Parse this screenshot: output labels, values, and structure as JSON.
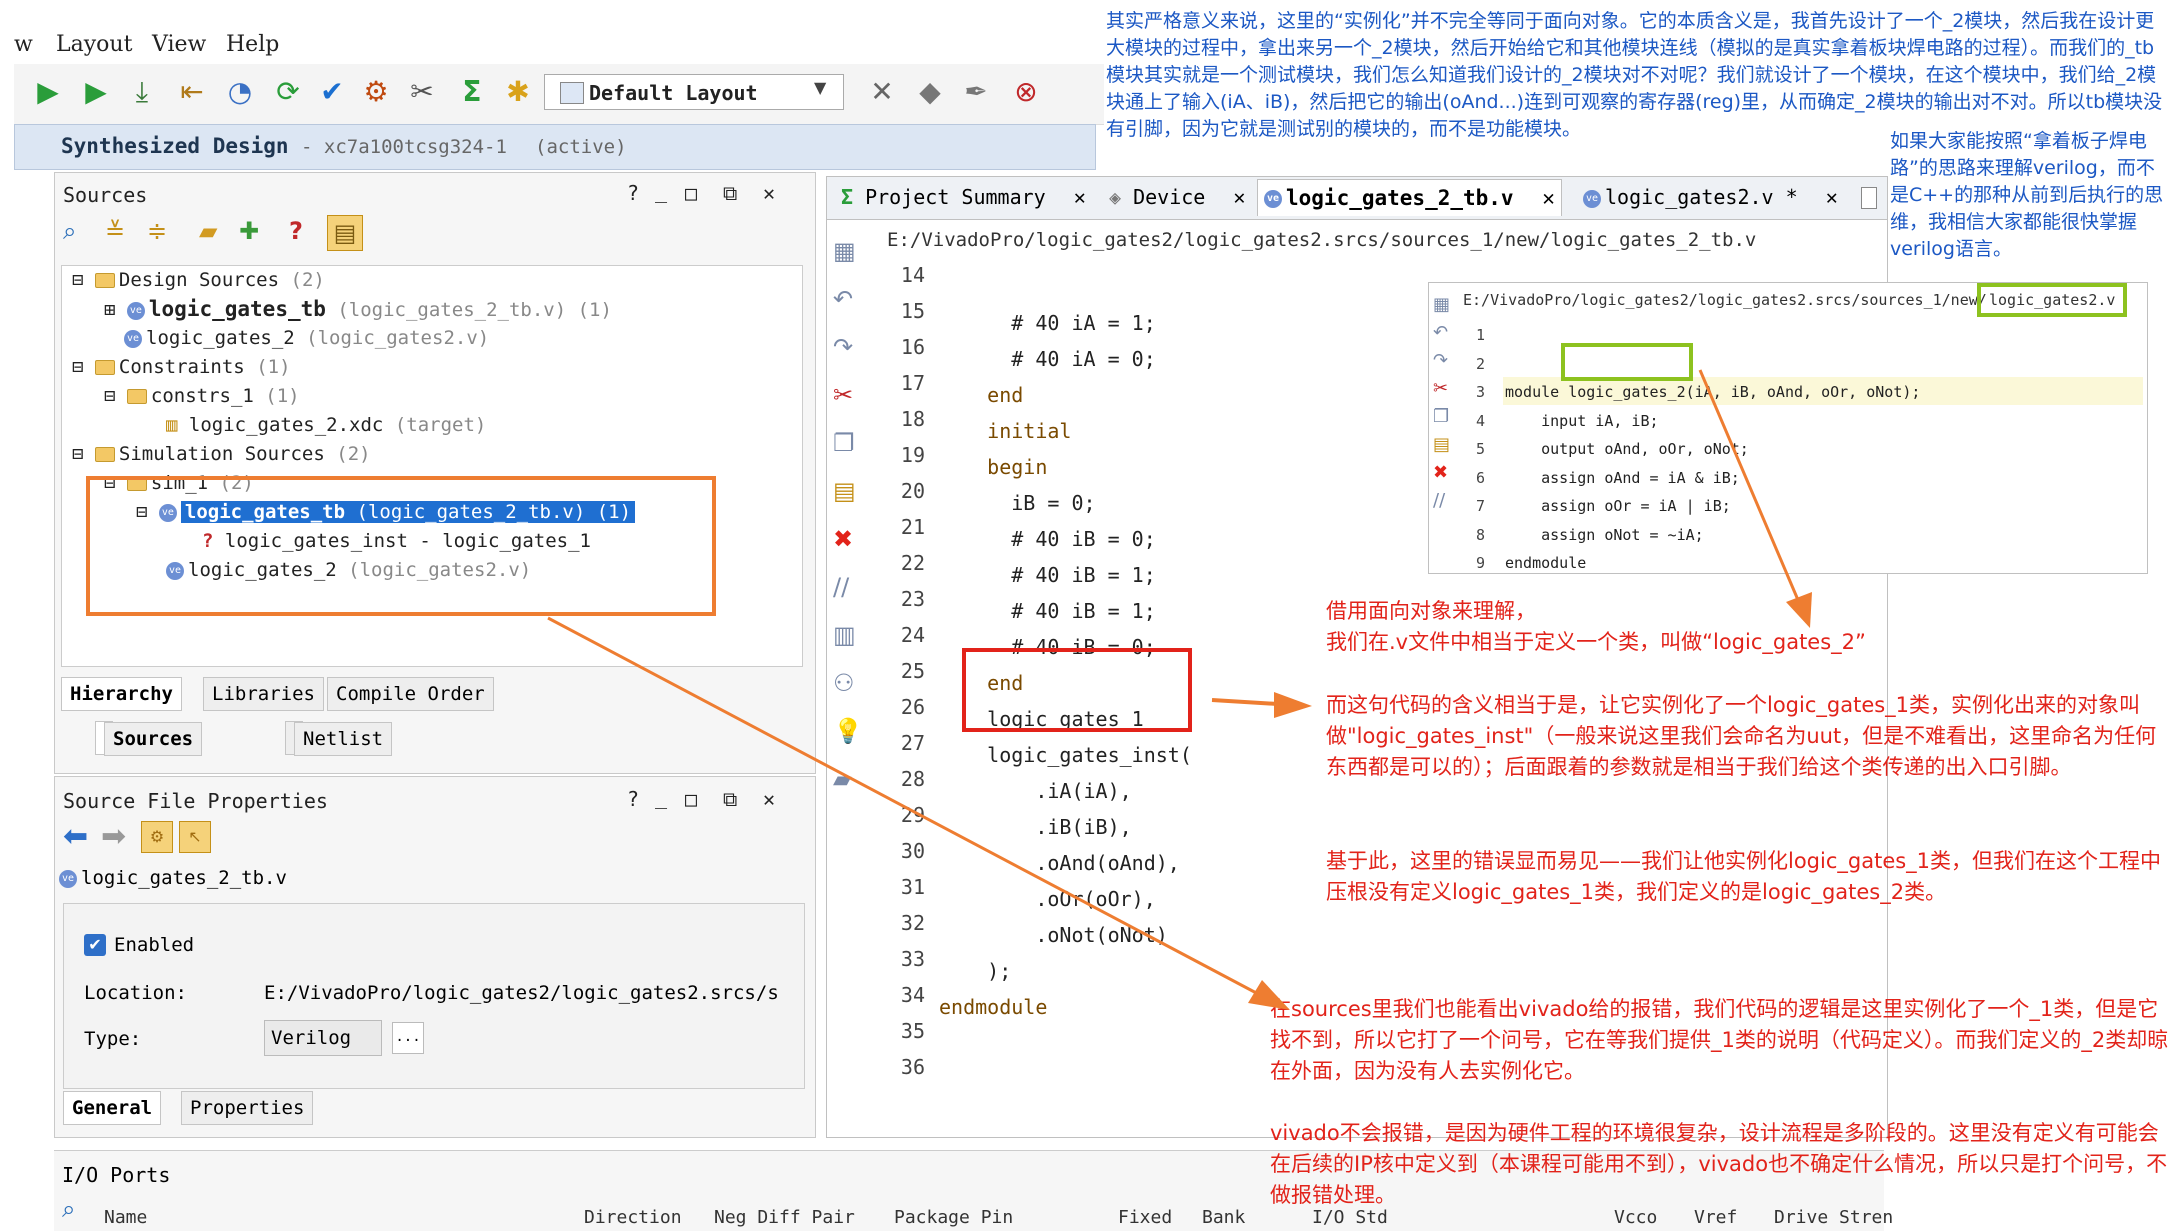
{
  "menu": [
    "w",
    "Layout",
    "View",
    "Help"
  ],
  "toolbar": {
    "layout_select": "Default Layout"
  },
  "title": {
    "main": "Synthesized Design",
    "detail": "- xc7a100tcsg324-1",
    "status": "(active)"
  },
  "sources": {
    "header": "Sources",
    "controls": [
      "?",
      "_",
      "□",
      "⧉",
      "✕"
    ],
    "tree": [
      {
        "label": "Design Sources",
        "extra": "(2)"
      },
      {
        "label": "logic_gates_tb",
        "extra": "(logic_gates_2_tb.v) (1)"
      },
      {
        "label": "logic_gates_2",
        "extra": "(logic_gates2.v)"
      },
      {
        "label": "Constraints",
        "extra": "(1)"
      },
      {
        "label": "constrs_1",
        "extra": "(1)"
      },
      {
        "label": "logic_gates_2.xdc",
        "extra": "(target)"
      },
      {
        "label": "Simulation Sources",
        "extra": "(2)"
      },
      {
        "label": "sim_1",
        "extra": "(2)"
      },
      {
        "label": "logic_gates_tb",
        "extra": "(logic_gates_2_tb.v) (1)"
      },
      {
        "label": "logic_gates_inst - logic_gates_1",
        "extra": ""
      },
      {
        "label": "logic_gates_2",
        "extra": "(logic_gates2.v)"
      }
    ],
    "bottom_tabs": [
      "Hierarchy",
      "Libraries",
      "Compile Order"
    ],
    "view_tabs": [
      "Sources",
      "Netlist"
    ]
  },
  "properties": {
    "header": "Source File Properties",
    "file": "logic_gates_2_tb.v",
    "enabled_label": "Enabled",
    "location_label": "Location:",
    "location_value": "E:/VivadoPro/logic_gates2/logic_gates2.srcs/s",
    "type_label": "Type:",
    "type_value": "Verilog",
    "more_button": "...",
    "tabs": [
      "General",
      "Properties"
    ]
  },
  "io_ports": {
    "header": "I/O Ports",
    "columns": [
      "Name",
      "Direction",
      "Neg Diff Pair",
      "Package Pin",
      "Fixed",
      "Bank",
      "I/O Std",
      "Vcco",
      "Vref",
      "Drive Stren"
    ]
  },
  "editor": {
    "tabs": [
      {
        "label": "Project Summary"
      },
      {
        "label": "Device"
      },
      {
        "label": "logic_gates_2_tb.v"
      },
      {
        "label": "logic_gates2.v *"
      }
    ],
    "path": "E:/VivadoPro/logic_gates2/logic_gates2.srcs/sources_1/new/logic_gates_2_tb.v",
    "line_numbers": [
      "14",
      "15",
      "16",
      "17",
      "18",
      "19",
      "20",
      "21",
      "22",
      "23",
      "24",
      "25",
      "26",
      "27",
      "28",
      "29",
      "30",
      "31",
      "32",
      "33",
      "34",
      "35",
      "36"
    ],
    "lines": [
      "      # 40 iA = 1;",
      "      # 40 iA = 0;",
      "    end",
      "    initial",
      "    begin",
      "      iB = 0;",
      "      # 40 iB = 0;",
      "      # 40 iB = 1;",
      "      # 40 iB = 1;",
      "      # 40 iB = 0;",
      "    end",
      "    logic_gates_1",
      "    logic_gates_inst(",
      "        .iA(iA),",
      "        .iB(iB),",
      "        .oAnd(oAnd),",
      "        .oOr(oOr),",
      "        .oNot(oNot)",
      "    );",
      "endmodule",
      "",
      "",
      ""
    ]
  },
  "inset": {
    "path": "E:/VivadoPro/logic_gates2/logic_gates2.srcs/sources_1/new/",
    "filename": "logic_gates2.v",
    "line_numbers": [
      "1",
      "2",
      "3",
      "4",
      "5",
      "6",
      "7",
      "8",
      "9"
    ],
    "lines": [
      "",
      "module logic_gates_2(iA, iB, oAnd, oOr, oNot);",
      "    input iA, iB;",
      "    output oAnd, oOr, oNot;",
      "    assign oAnd = iA & iB;",
      "    assign oOr = iA | iB;",
      "    assign oNot = ~iA;",
      "endmodule",
      ""
    ]
  },
  "annotations": {
    "top_blue": "其实严格意义来说，这里的“实例化”并不完全等同于面向对象。它的本质含义是，我首先设计了一个_2模块，然后我在设计更大模块的过程中，拿出来另一个_2模块，然后开始给它和其他模块连线（模拟的是真实拿着板块焊电路的过程）。而我们的_tb模块其实就是一个测试模块，我们怎么知道我们设计的_2模块对不对呢？我们就设计了一个模块，在这个模块中，我们给_2模块通上了输入(iA、iB)，然后把它的输出(oAnd...)连到可观察的寄存器(reg)里，从而确定_2模块的输出对不对。所以tb模块没有引脚，因为它就是测试别的模块的，而不是功能模块。",
    "side_blue": "如果大家能按照“拿着板子焊电路”的思路来理解verilog，而不是C++的那种从前到后执行的思维，我相信大家都能很快掌握verilog语言。",
    "red_1": "借用面向对象来理解，\n我们在.v文件中相当于定义一个类，叫做“logic_gates_2”",
    "red_2": "而这句代码的含义相当于是，让它实例化了一个logic_gates_1类，实例化出来的对象叫做\"logic_gates_inst\"（一般来说这里我们会命名为uut，但是不难看出，这里命名为任何东西都是可以的）；后面跟着的参数就是相当于我们给这个类传递的出入口引脚。",
    "red_3": "基于此，这里的错误显而易见——我们让他实例化logic_gates_1类，但我们在这个工程中压根没有定义logic_gates_1类，我们定义的是logic_gates_2类。",
    "red_4": "在sources里我们也能看出vivado给的报错，我们代码的逻辑是这里实例化了一个_1类，但是它找不到，所以它打了一个问号，它在等我们提供_1类的说明（代码定义）。而我们定义的_2类却晾在外面，因为没有人去实例化它。",
    "red_5": "vivado不会报错，是因为硬件工程的环境很复杂，设计流程是多阶段的。这里没有定义有可能会在后续的IP核中定义到（本课程可能用不到），vivado也不确定什么情况，所以只是打个问号，不做报错处理。"
  },
  "colors": {
    "orange": "#ee7d31",
    "red": "#e2231a",
    "green": "#8dc21f",
    "blue": "#1c58c4",
    "selection": "#1f6fd1"
  }
}
